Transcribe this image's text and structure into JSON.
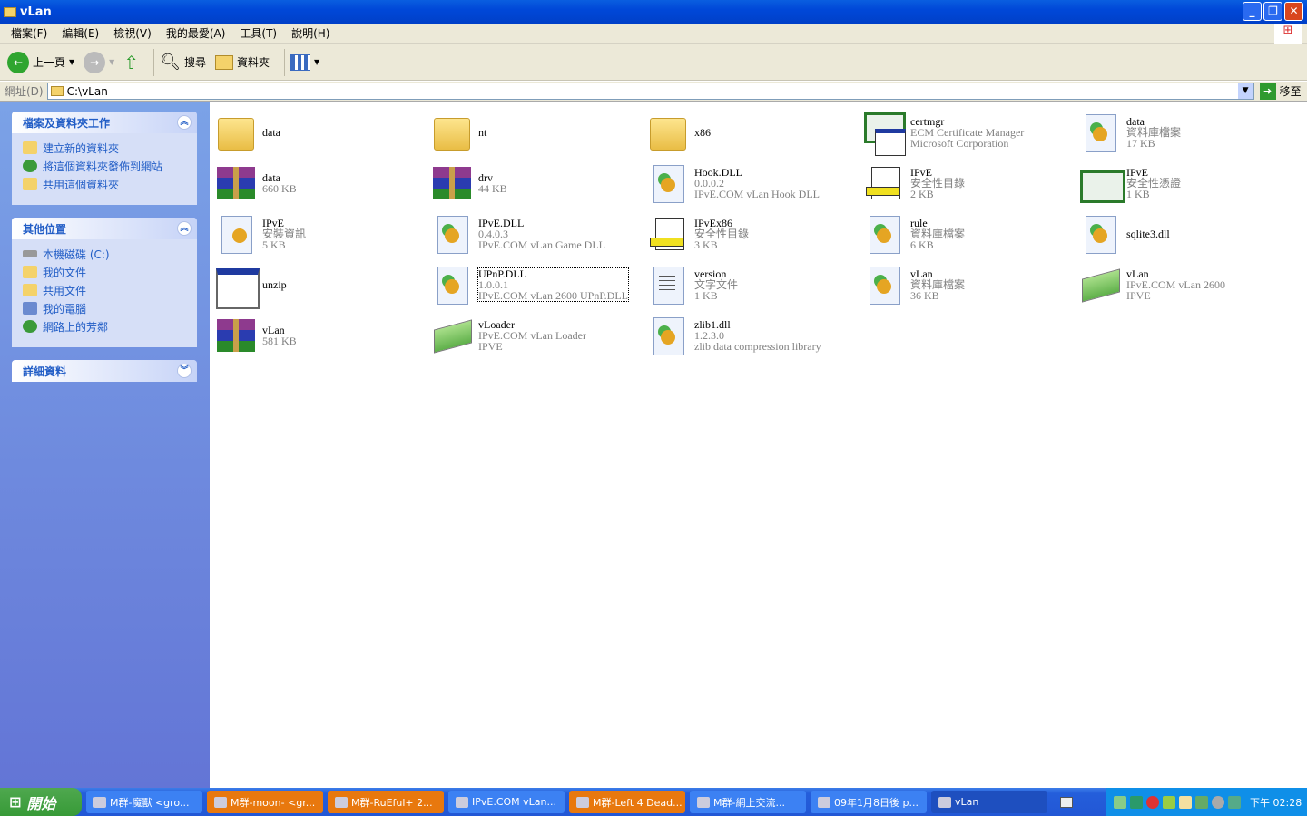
{
  "window": {
    "title": "vLan"
  },
  "menu": [
    "檔案(F)",
    "編輯(E)",
    "檢視(V)",
    "我的最愛(A)",
    "工具(T)",
    "說明(H)"
  ],
  "toolbar": {
    "back": "上一頁",
    "search": "搜尋",
    "folders": "資料夾"
  },
  "address": {
    "label": "網址(D)",
    "value": "C:\\vLan",
    "go": "移至"
  },
  "sidebar": {
    "tasks": {
      "title": "檔案及資料夾工作",
      "items": [
        "建立新的資料夾",
        "將這個資料夾發佈到網站",
        "共用這個資料夾"
      ]
    },
    "places": {
      "title": "其他位置",
      "items": [
        "本機磁碟 (C:)",
        "我的文件",
        "共用文件",
        "我的電腦",
        "網路上的芳鄰"
      ]
    },
    "details": {
      "title": "詳細資料"
    }
  },
  "files": [
    {
      "icon": "folder",
      "name": "data",
      "l2": "",
      "l3": ""
    },
    {
      "icon": "folder",
      "name": "nt",
      "l2": "",
      "l3": ""
    },
    {
      "icon": "folder",
      "name": "x86",
      "l2": "",
      "l3": ""
    },
    {
      "icon": "certmgr",
      "name": "certmgr",
      "l2": "ECM Certificate Manager",
      "l3": "Microsoft Corporation"
    },
    {
      "icon": "dll",
      "name": "data",
      "l2": "資料庫檔案",
      "l3": "17 KB"
    },
    {
      "icon": "rar",
      "name": "data",
      "l2": "660 KB",
      "l3": ""
    },
    {
      "icon": "rar",
      "name": "drv",
      "l2": "44 KB",
      "l3": ""
    },
    {
      "icon": "dll",
      "name": "Hook.DLL",
      "l2": "0.0.0.2",
      "l3": "IPvE.COM vLan Hook DLL"
    },
    {
      "icon": "cat",
      "name": "IPvE",
      "l2": "安全性目錄",
      "l3": "2 KB"
    },
    {
      "icon": "cert",
      "name": "IPvE",
      "l2": "安全性憑證",
      "l3": "1 KB"
    },
    {
      "icon": "inf",
      "name": "IPvE",
      "l2": "安裝資訊",
      "l3": "5 KB"
    },
    {
      "icon": "dll",
      "name": "IPvE.DLL",
      "l2": "0.4.0.3",
      "l3": "IPvE.COM vLan Game DLL"
    },
    {
      "icon": "cat",
      "name": "IPvEx86",
      "l2": "安全性目錄",
      "l3": "3 KB"
    },
    {
      "icon": "dll",
      "name": "rule",
      "l2": "資料庫檔案",
      "l3": "6 KB"
    },
    {
      "icon": "dll",
      "name": "sqlite3.dll",
      "l2": "",
      "l3": ""
    },
    {
      "icon": "exe",
      "name": "unzip",
      "l2": "",
      "l3": ""
    },
    {
      "icon": "dll",
      "name": "UPnP.DLL",
      "l2": "1.0.0.1",
      "l3": "IPvE.COM vLan 2600  UPnP.DLL",
      "selected": true
    },
    {
      "icon": "txt",
      "name": "version",
      "l2": "文字文件",
      "l3": "1 KB"
    },
    {
      "icon": "dll",
      "name": "vLan",
      "l2": "資料庫檔案",
      "l3": "36 KB"
    },
    {
      "icon": "card",
      "name": "vLan",
      "l2": "IPvE.COM vLan 2600",
      "l3": "IPVE"
    },
    {
      "icon": "rar",
      "name": "vLan",
      "l2": "581 KB",
      "l3": ""
    },
    {
      "icon": "card",
      "name": "vLoader",
      "l2": "IPvE.COM vLan Loader",
      "l3": "IPVE"
    },
    {
      "icon": "dll",
      "name": "zlib1.dll",
      "l2": "1.2.3.0",
      "l3": "zlib data compression library"
    }
  ],
  "taskbar": {
    "start": "開始",
    "buttons": [
      {
        "label": "M群-魔獸 <gro...",
        "style": "blue"
      },
      {
        "label": "M群-moon- <gr...",
        "style": "orange"
      },
      {
        "label": "M群-RuEful+  2...",
        "style": "orange"
      },
      {
        "label": "IPvE.COM vLan...",
        "style": "blue"
      },
      {
        "label": "M群-Left 4 Dead...",
        "style": "orange"
      },
      {
        "label": "M群-網上交流...",
        "style": "blue"
      },
      {
        "label": "09年1月8日後 p...",
        "style": "blue"
      },
      {
        "label": "vLan",
        "style": "active"
      }
    ],
    "clock": "下午 02:28"
  }
}
